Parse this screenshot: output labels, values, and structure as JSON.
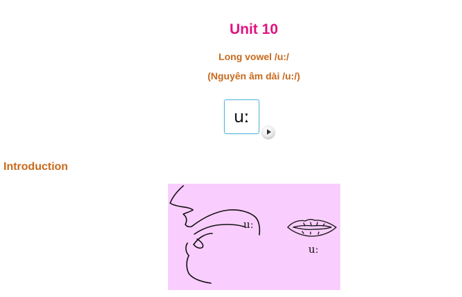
{
  "header": {
    "title": "Unit 10",
    "subtitle": "Long vowel /u:/",
    "subtitle_vi": "(Nguyên âm dài /u:/)"
  },
  "phoneme": {
    "symbol": "uː",
    "play_icon": "play-icon"
  },
  "section": {
    "heading": "Introduction"
  },
  "illustration": {
    "mouth_label": "uː",
    "lips_label": "uː",
    "background_color": "#f9cdfd"
  },
  "colors": {
    "title": "#e0117f",
    "subtitle": "#c8691c",
    "card_border": "#58b7dd"
  }
}
